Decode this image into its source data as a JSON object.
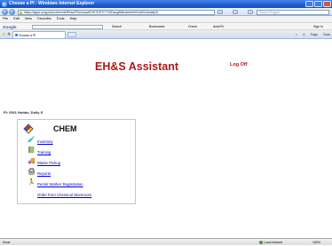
{
  "window": {
    "title": "Choose a PI - Windows Internet Explorer"
  },
  "address_bar": {
    "url": "https://apps.ucsg.edu/chem/defEhsa/PI/chooseEHS?DETCTV3Dsug9b8cdebe6h%3a%2dodelj2it",
    "search_placeholder": "Search Engine"
  },
  "menu": {
    "items": [
      "File",
      "Edit",
      "View",
      "Favorites",
      "Tools",
      "Help"
    ]
  },
  "google_toolbar": {
    "logo": "Google",
    "items": [
      "Search",
      "Bookmarks",
      "Check",
      "AutoFill"
    ],
    "signin": "Sign In"
  },
  "tabs": {
    "active_label": "Choose a PI",
    "tools": [
      "Page",
      "Tools"
    ]
  },
  "page": {
    "app_title": "EH&S Assistant",
    "logoff": "Log Off",
    "pi_label": "PI: 0011 Hobbs, Dolly S",
    "panel_title": "CHEM",
    "menu_items": [
      {
        "label": "Inventory",
        "icon": "flask-icon"
      },
      {
        "label": "Training",
        "icon": "training-icon"
      },
      {
        "label": "Waste Pickup",
        "icon": "truck-icon"
      },
      {
        "label": "Reports",
        "icon": "printer-icon"
      },
      {
        "label": "Permit Worker Registration",
        "icon": "worker-icon"
      },
      {
        "label": "Order from Chemical Storeroom",
        "icon": ""
      }
    ]
  },
  "status_bar": {
    "status": "Done",
    "zone": "Local intranet",
    "zoom": "100%"
  },
  "colors": {
    "title_red": "#b01818",
    "link_blue": "#0000cc",
    "titlebar_blue": "#1f5fd4"
  }
}
